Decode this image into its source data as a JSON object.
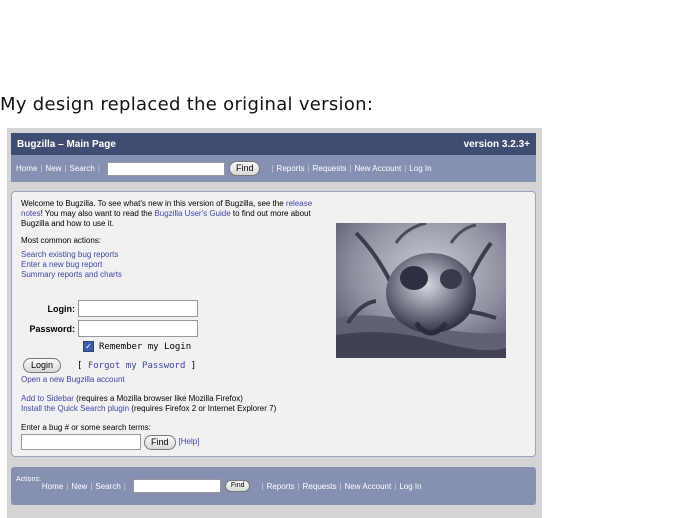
{
  "caption": "My design replaced the original version:",
  "app": {
    "title": "Bugzilla – Main Page",
    "version": "version 3.2.3+"
  },
  "nav": {
    "home": "Home",
    "new": "New",
    "search": "Search",
    "find_button": "Find",
    "reports": "Reports",
    "requests": "Requests",
    "new_account": "New Account",
    "log_in": "Log In"
  },
  "welcome": {
    "part1": "Welcome to Bugzilla. To see what's new in this version of Bugzilla, see the ",
    "release_notes": "release notes",
    "part2": "! You may also want to read the ",
    "users_guide": "Bugzilla User's Guide",
    "part3": " to find out more about Bugzilla and how to use it."
  },
  "common_actions": {
    "heading": "Most common actions:",
    "links": [
      "Search existing bug reports",
      "Enter a new bug report",
      "Summary reports and charts"
    ]
  },
  "login_form": {
    "login_label": "Login:",
    "password_label": "Password:",
    "remember_label": "Remember my Login",
    "login_button": "Login",
    "forgot_open": "[ ",
    "forgot_link": "Forgot my Password",
    "forgot_close": " ]",
    "open_account": "Open a new Bugzilla account"
  },
  "extras": {
    "add_sidebar": "Add to Sidebar",
    "add_sidebar_note": " (requires a Mozilla browser like Mozilla Firefox)",
    "quick_search": "Install the Quick Search plugin",
    "quick_search_note": " (requires Firefox 2 or Internet Explorer 7)"
  },
  "bug_search": {
    "label": "Enter a bug # or some search terms:",
    "find_button": "Find",
    "help": "[Help]"
  },
  "footer": {
    "actions_label": "Actions:",
    "home": "Home",
    "new": "New",
    "search": "Search",
    "find_button": "Find",
    "reports": "Reports",
    "requests": "Requests",
    "new_account": "New Account",
    "log_in": "Log In"
  },
  "colors": {
    "title_bar": "#3f4d72",
    "nav_bar": "#8590b3",
    "link": "#3f47a8",
    "content_bg": "#f1f1f1"
  }
}
